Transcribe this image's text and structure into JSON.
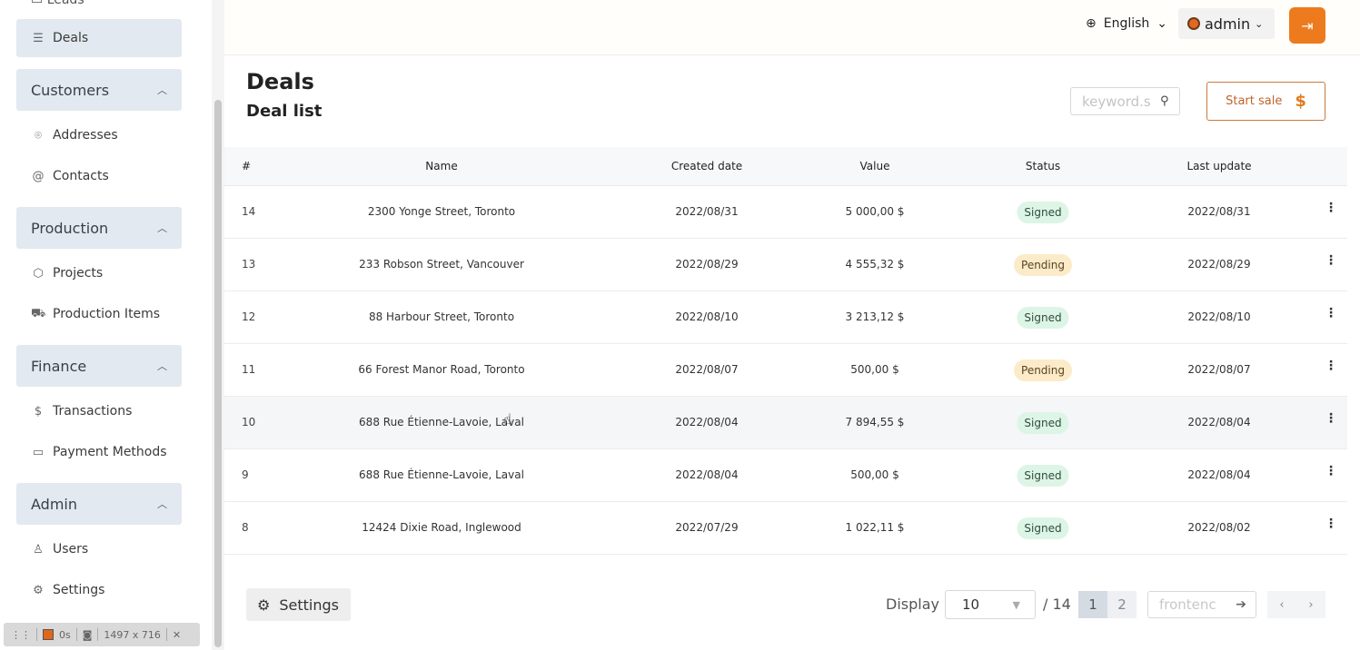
{
  "sidebar": {
    "cut_item": "Leads",
    "items": {
      "deals": "Deals",
      "addresses": "Addresses",
      "contacts": "Contacts",
      "projects": "Projects",
      "production_items": "Production Items",
      "transactions": "Transactions",
      "payment_methods": "Payment Methods",
      "users": "Users",
      "settings": "Settings"
    },
    "groups": {
      "customers": "Customers",
      "production": "Production",
      "finance": "Finance",
      "admin": "Admin"
    }
  },
  "recorder": {
    "time": "0s",
    "size": "1497 x 716"
  },
  "topbar": {
    "language": "English",
    "user": "admin"
  },
  "header": {
    "title": "Deals",
    "subtitle": "Deal list"
  },
  "search": {
    "placeholder": "keyword.s"
  },
  "start_sale": {
    "label": "Start sale",
    "icon": "$"
  },
  "table": {
    "columns": [
      "#",
      "Name",
      "Created date",
      "Value",
      "Status",
      "Last update"
    ],
    "rows": [
      [
        "14",
        "2300 Yonge Street, Toronto",
        "2022/08/31",
        "5 000,00 $",
        "Signed",
        "2022/08/31"
      ],
      [
        "13",
        "233 Robson Street, Vancouver",
        "2022/08/29",
        "4 555,32 $",
        "Pending",
        "2022/08/29"
      ],
      [
        "12",
        "88 Harbour Street, Toronto",
        "2022/08/10",
        "3 213,12 $",
        "Signed",
        "2022/08/10"
      ],
      [
        "11",
        "66 Forest Manor Road, Toronto",
        "2022/08/07",
        "500,00 $",
        "Pending",
        "2022/08/07"
      ],
      [
        "10",
        "688 Rue Étienne-Lavoie, Laval",
        "2022/08/04",
        "7 894,55 $",
        "Signed",
        "2022/08/04"
      ],
      [
        "9",
        "688 Rue Étienne-Lavoie, Laval",
        "2022/08/04",
        "500,00 $",
        "Signed",
        "2022/08/04"
      ],
      [
        "8",
        "12424 Dixie Road, Inglewood",
        "2022/07/29",
        "1 022,11 $",
        "Signed",
        "2022/08/02"
      ]
    ]
  },
  "footer": {
    "settings_label": "Settings",
    "display_label": "Display",
    "page_size": "10",
    "total": "/ 14",
    "pages": [
      "1",
      "2"
    ],
    "goto_placeholder": "frontenc",
    "prev": "‹",
    "next": "›"
  },
  "colors": {
    "accent": "#ee7a1e",
    "signed_bg": "#dcf5e6",
    "pending_bg": "#fcebc8"
  }
}
